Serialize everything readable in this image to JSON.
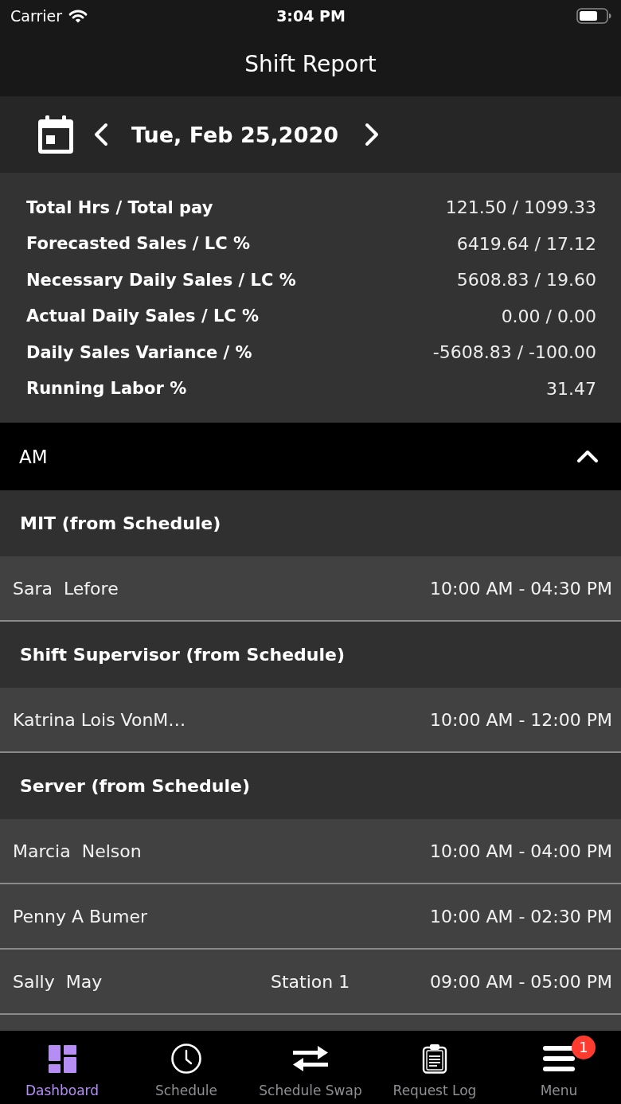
{
  "status_bar": {
    "carrier": "Carrier",
    "time": "3:04 PM"
  },
  "nav_bar": {
    "title": "Shift Report"
  },
  "date_bar": {
    "date": "Tue, Feb 25,2020"
  },
  "summary": [
    {
      "label": "Total Hrs / Total pay",
      "value": "121.50 / 1099.33"
    },
    {
      "label": "Forecasted Sales / LC %",
      "value": "6419.64 / 17.12"
    },
    {
      "label": "Necessary Daily Sales / LC %",
      "value": "5608.83 / 19.60"
    },
    {
      "label": "Actual Daily Sales / LC %",
      "value": "0.00 / 0.00"
    },
    {
      "label": "Daily Sales Variance / %",
      "value": "-5608.83 / -100.00"
    },
    {
      "label": "Running Labor %",
      "value": "31.47"
    }
  ],
  "sections": [
    {
      "title": "AM",
      "expanded": true,
      "groups": [
        {
          "title": "MIT (from Schedule)",
          "rows": [
            {
              "name": "Sara  Lefore",
              "time": "10:00 AM - 04:30 PM"
            }
          ]
        },
        {
          "title": "Shift Supervisor (from Schedule)",
          "rows": [
            {
              "name": "Katrina Lois VonM…",
              "time": "10:00 AM - 12:00 PM"
            }
          ]
        },
        {
          "title": "Server (from Schedule)",
          "rows": [
            {
              "name": "Marcia  Nelson",
              "time": "10:00 AM - 04:00 PM"
            },
            {
              "name": "Penny A Bumer",
              "time": "10:00 AM - 02:30 PM"
            },
            {
              "name": "Sally  May",
              "station": "Station 1",
              "time": "09:00 AM - 05:00 PM"
            }
          ]
        }
      ]
    }
  ],
  "tab_bar": [
    {
      "label": "Dashboard",
      "selected": true
    },
    {
      "label": "Schedule",
      "selected": false
    },
    {
      "label": "Schedule Swap",
      "selected": false
    },
    {
      "label": "Request Log",
      "selected": false
    },
    {
      "label": "Menu",
      "selected": false,
      "badge": "1"
    }
  ]
}
